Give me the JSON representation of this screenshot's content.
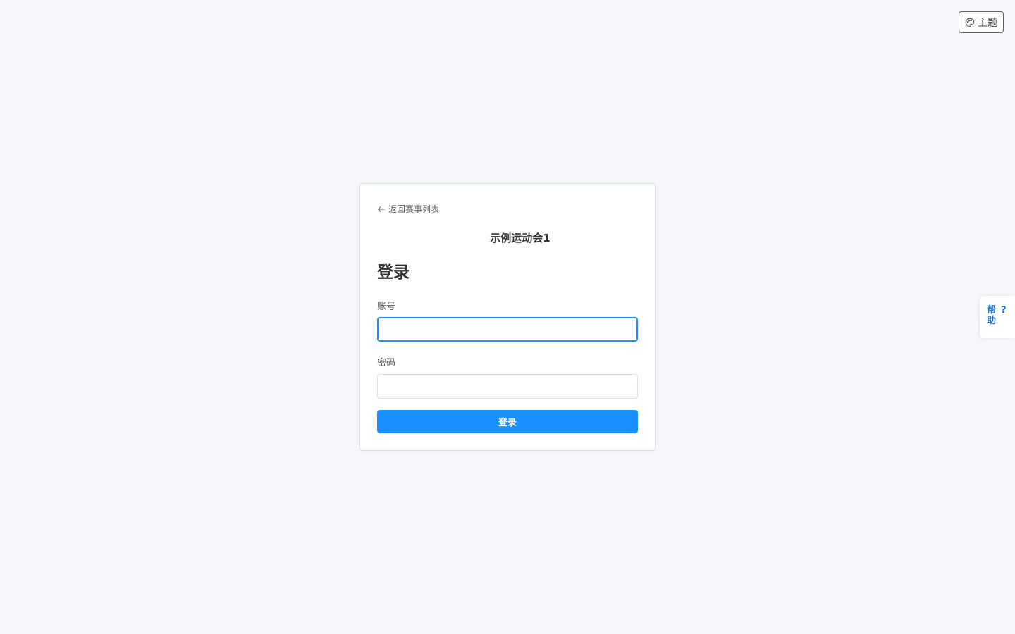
{
  "header": {
    "theme_label": "主题",
    "theme_icon": "palette-icon"
  },
  "card": {
    "back_label": "返回赛事列表",
    "back_icon": "arrow-left-icon",
    "event_title": "示例运动会1",
    "heading": "登录",
    "account_label": "账号",
    "account_value": "",
    "password_label": "密码",
    "password_value": "",
    "submit_label": "登录"
  },
  "help": {
    "label": "帮助",
    "icon": "?"
  },
  "colors": {
    "primary": "#1890ff",
    "background": "#f5f7fa",
    "help_text": "#1768c4"
  }
}
